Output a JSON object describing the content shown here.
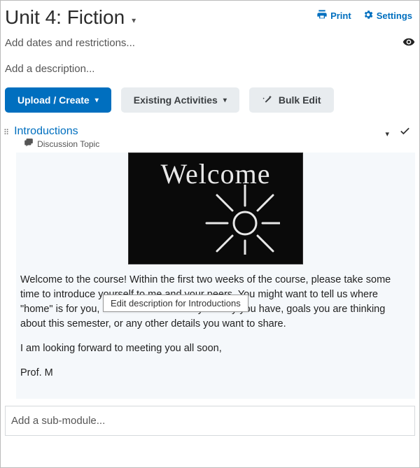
{
  "header": {
    "title": "Unit 4: Fiction",
    "print": "Print",
    "settings": "Settings"
  },
  "meta": {
    "dates_placeholder": "Add dates and restrictions...",
    "description_placeholder": "Add a description..."
  },
  "toolbar": {
    "upload": "Upload / Create",
    "existing": "Existing Activities",
    "bulk": "Bulk Edit"
  },
  "topic": {
    "title": "Introductions",
    "type": "Discussion Topic",
    "chalk_text": "Welcome",
    "tooltip": "Edit description for Introductions",
    "para1": "Welcome to the course! Within the first two weeks of the course, please take some time to introduce yourself to me and your peers. You might want to tell us where \"home\" is for you, about a favorite hobby/activity you have, goals you are thinking about this semester, or any other details you want to share.",
    "para2": "I am looking forward to meeting you all soon,",
    "signoff": "Prof. M"
  },
  "submodule_placeholder": "Add a sub-module..."
}
